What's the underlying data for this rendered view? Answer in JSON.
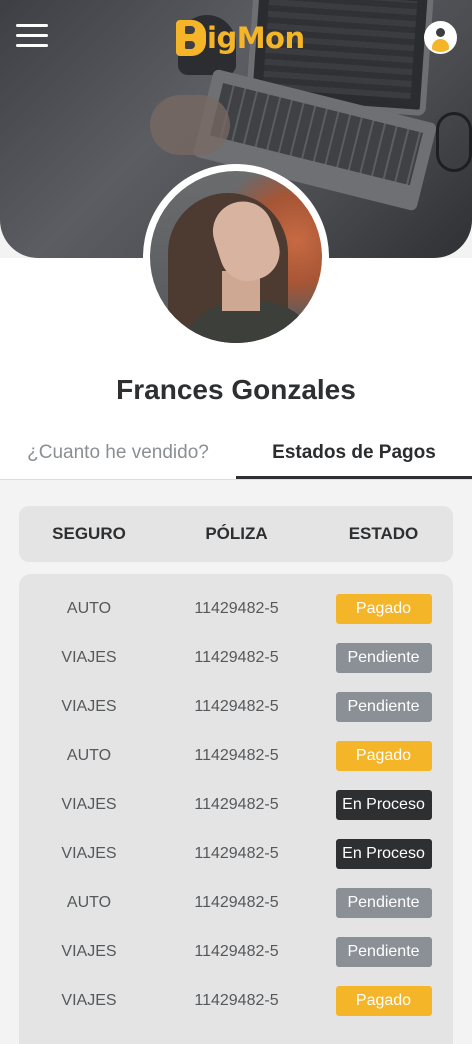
{
  "app": {
    "logo_text": "igMon",
    "brand_color": "#f5b529"
  },
  "header": {
    "menu_icon": "hamburger-icon",
    "user_icon": "user-icon"
  },
  "profile": {
    "name": "Frances Gonzales"
  },
  "tabs": [
    {
      "label": "¿Cuanto he vendido?",
      "active": false
    },
    {
      "label": "Estados de Pagos",
      "active": true
    }
  ],
  "table": {
    "headers": {
      "seguro": "SEGURO",
      "poliza": "PÓLIZA",
      "estado": "ESTADO"
    },
    "rows": [
      {
        "seguro": "AUTO",
        "poliza": "11429482-5",
        "estado": "Pagado",
        "status": "pagado"
      },
      {
        "seguro": "VIAJES",
        "poliza": "11429482-5",
        "estado": "Pendiente",
        "status": "pendiente"
      },
      {
        "seguro": "VIAJES",
        "poliza": "11429482-5",
        "estado": "Pendiente",
        "status": "pendiente"
      },
      {
        "seguro": "AUTO",
        "poliza": "11429482-5",
        "estado": "Pagado",
        "status": "pagado"
      },
      {
        "seguro": "VIAJES",
        "poliza": "11429482-5",
        "estado": "En Proceso",
        "status": "proceso"
      },
      {
        "seguro": "VIAJES",
        "poliza": "11429482-5",
        "estado": "En Proceso",
        "status": "proceso"
      },
      {
        "seguro": "AUTO",
        "poliza": "11429482-5",
        "estado": "Pendiente",
        "status": "pendiente"
      },
      {
        "seguro": "VIAJES",
        "poliza": "11429482-5",
        "estado": "Pendiente",
        "status": "pendiente"
      },
      {
        "seguro": "VIAJES",
        "poliza": "11429482-5",
        "estado": "Pagado",
        "status": "pagado"
      }
    ]
  },
  "status_colors": {
    "pagado": "#f5b529",
    "pendiente": "#8a9096",
    "proceso": "#2e2f31"
  }
}
